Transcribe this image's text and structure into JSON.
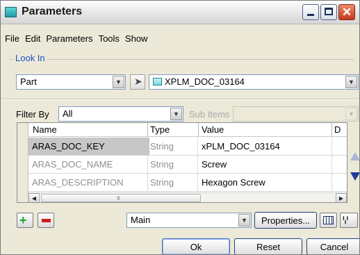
{
  "window": {
    "title": "Parameters"
  },
  "menu": [
    "File",
    "Edit",
    "Parameters",
    "Tools",
    "Show"
  ],
  "look_in": {
    "label": "Look In",
    "type_value": "Part",
    "item_value": "XPLM_DOC_03164"
  },
  "filter": {
    "label": "Filter By",
    "value": "All",
    "sub_items_label": "Sub Items",
    "sub_items_value": ""
  },
  "grid": {
    "columns": [
      "Name",
      "Type",
      "Value",
      "D"
    ],
    "rows": [
      {
        "name": "ARAS_DOC_KEY",
        "type": "String",
        "value": "xPLM_DOC_03164"
      },
      {
        "name": "ARAS_DOC_NAME",
        "type": "String",
        "value": "Screw"
      },
      {
        "name": "ARAS_DESCRIPTION",
        "type": "String",
        "value": "Hexagon Screw"
      }
    ],
    "scroll_grip": "III"
  },
  "toolbar": {
    "view_value": "Main",
    "properties_label": "Properties..."
  },
  "buttons": {
    "ok": "Ok",
    "reset": "Reset",
    "cancel": "Cancel"
  },
  "colors": {
    "accent": "#1d4fbf",
    "close": "#c5381c",
    "add": "#19a12b",
    "remove": "#d11d1d"
  }
}
